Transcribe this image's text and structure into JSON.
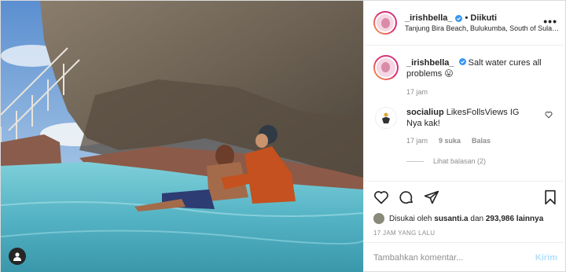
{
  "post": {
    "username": "_irishbella_",
    "follow_separator": "•",
    "follow_status": "Diikuti",
    "location": "Tanjung Bira Beach, Bulukumba, South of Sulawesi",
    "more_label": "•••",
    "caption": {
      "username": "_irishbella_",
      "text": "Salt water cures all problems 😛",
      "time": "17 jam"
    },
    "comments": [
      {
        "username": "socialiup",
        "text": "LikesFollsViews IG Nya kak!",
        "time": "17 jam",
        "likes": "9 suka",
        "reply_label": "Balas",
        "view_replies": "Lihat balasan (2)"
      }
    ],
    "likes": {
      "prefix": "Disukai oleh",
      "user": "susanti.a",
      "middle": "dan",
      "count": "293,986 lainnya"
    },
    "timestamp": "17 JAM YANG LALU",
    "comment_input": {
      "placeholder": "Tambahkan komentar..."
    },
    "post_button": "Kirim"
  },
  "icons": {
    "heart": "heart-icon",
    "comment": "comment-icon",
    "share": "paper-plane-icon",
    "bookmark": "bookmark-icon",
    "verified": "verified-badge-icon",
    "user_tag": "user-tag-icon"
  },
  "colors": {
    "verified": "#3897f0",
    "post_button_disabled": "#b2dffc",
    "secondary_text": "#8e8e8e"
  }
}
